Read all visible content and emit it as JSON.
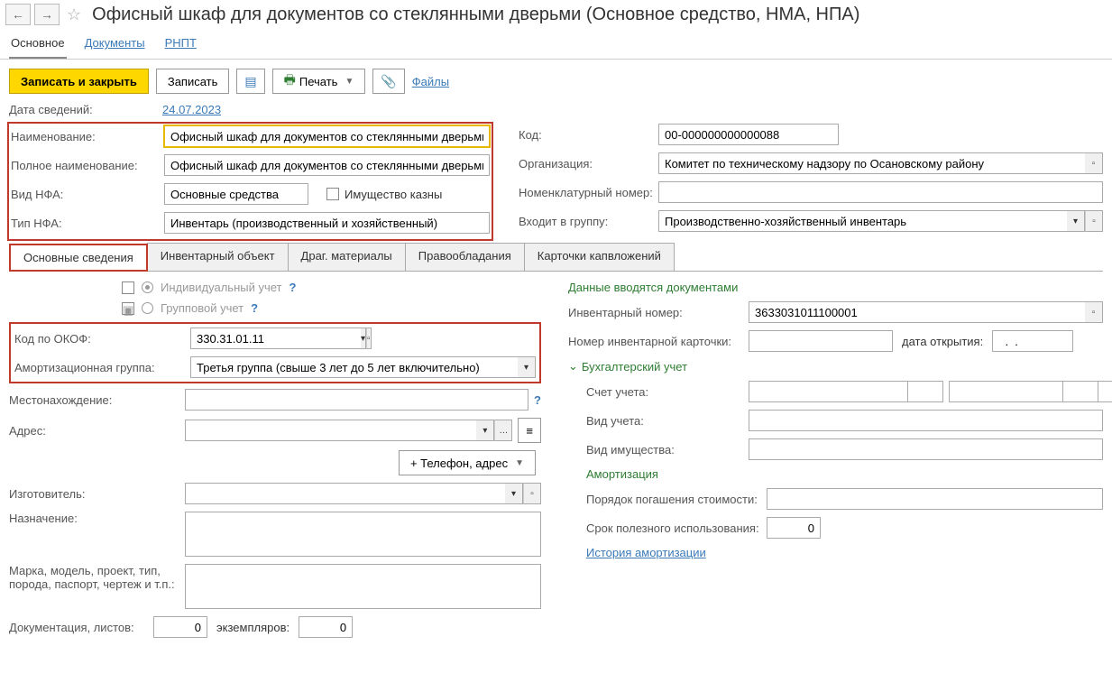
{
  "header": {
    "title": "Офисный шкаф для документов со стеклянными дверьми (Основное средство, НМА, НПА)"
  },
  "nav": {
    "main": "Основное",
    "documents": "Документы",
    "rnpt": "РНПТ"
  },
  "toolbar": {
    "save_close": "Записать и закрыть",
    "save": "Записать",
    "print": "Печать",
    "files": "Файлы"
  },
  "info_date": {
    "label": "Дата сведений:",
    "value": "24.07.2023"
  },
  "name": {
    "label": "Наименование:",
    "value": "Офисный шкаф для документов со стеклянными дверьми"
  },
  "full_name": {
    "label": "Полное наименование:",
    "value": "Офисный шкаф для документов со стеклянными дверьми"
  },
  "nfa_kind": {
    "label": "Вид НФА:",
    "value": "Основные средства",
    "checkbox": "Имущество казны"
  },
  "nfa_type": {
    "label": "Тип НФА:",
    "value": "Инвентарь (производственный и хозяйственный)"
  },
  "code": {
    "label": "Код:",
    "value": "00-000000000000088"
  },
  "org": {
    "label": "Организация:",
    "value": "Комитет по техническому надзору по Осановскому району"
  },
  "nomen_num": {
    "label": "Номенклатурный номер:",
    "value": ""
  },
  "group": {
    "label": "Входит в группу:",
    "value": "Производственно-хозяйственный инвентарь"
  },
  "subtabs": {
    "t0": "Основные сведения",
    "t1": "Инвентарный объект",
    "t2": "Драг. материалы",
    "t3": "Правообладания",
    "t4": "Карточки капвложений"
  },
  "radio": {
    "individual": "Индивидуальный учет",
    "group": "Групповой учет"
  },
  "okof": {
    "label": "Код по ОКОФ:",
    "value": "330.31.01.11"
  },
  "amort_group": {
    "label": "Амортизационная группа:",
    "value": "Третья группа (свыше 3 лет до 5 лет включительно)"
  },
  "location": {
    "label": "Местонахождение:",
    "value": ""
  },
  "address": {
    "label": "Адрес:",
    "value": ""
  },
  "add_contact_btn": "+ Телефон, адрес",
  "manufacturer": {
    "label": "Изготовитель:",
    "value": ""
  },
  "purpose": {
    "label": "Назначение:",
    "value": ""
  },
  "brand_model": {
    "label": "Марка, модель, проект, тип, порода, паспорт, чертеж и т.п.:",
    "value": ""
  },
  "documentation": {
    "label": "Документация, листов:",
    "value": "0",
    "copies_label": "экземпляров:",
    "copies": "0"
  },
  "right": {
    "docs_header": "Данные вводятся документами",
    "inv_num": {
      "label": "Инвентарный номер:",
      "value": "3633031011100001"
    },
    "card_num": {
      "label": "Номер инвентарной карточки:",
      "value": "",
      "date_label": "дата открытия:",
      "date": "  .  .    "
    },
    "buh_header": "Бухгалтерский учет",
    "account": {
      "label": "Счет учета:",
      "value": ""
    },
    "acct_kind": {
      "label": "Вид учета:",
      "value": ""
    },
    "prop_kind": {
      "label": "Вид имущества:",
      "value": ""
    },
    "amort_header": "Амортизация",
    "pay_order": {
      "label": "Порядок погашения стоимости:",
      "value": ""
    },
    "useful_life": {
      "label": "Срок полезного использования:",
      "value": "0"
    },
    "amort_history": "История амортизации"
  }
}
